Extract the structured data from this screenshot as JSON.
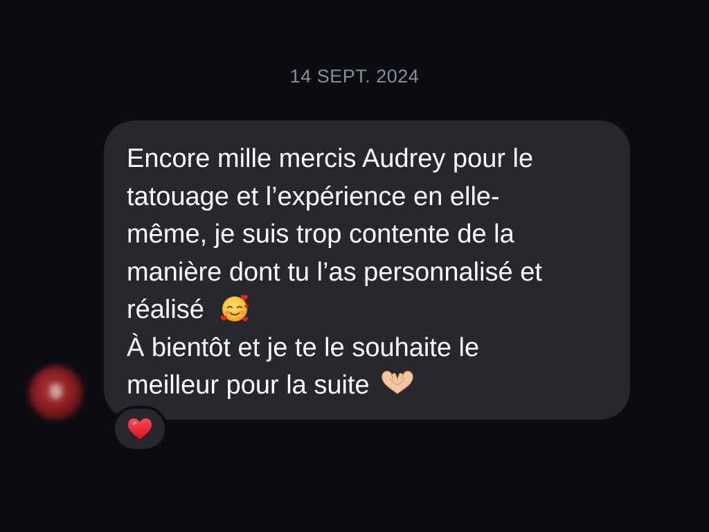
{
  "conversation": {
    "date_separator": "14 SEPT. 2024"
  },
  "message": {
    "lines": [
      "Encore mille mercis Audrey pour le",
      "tatouage et l’expérience en elle-",
      "même, je suis trop contente de la",
      "manière dont tu l’as personnalisé et",
      "réalisé",
      "À bientôt et je te le souhaite le",
      "meilleur pour la suite"
    ],
    "emojis": {
      "after_line_5": "smiling-face-with-hearts",
      "after_line_7": "heart-hands"
    },
    "bubble_color": "#26282e",
    "text_color": "#ffffff"
  },
  "reaction": {
    "icon": "red-heart-icon",
    "color": "#e8202c"
  },
  "sender": {
    "avatar": "blurred-avatar"
  },
  "theme": {
    "background": "#0b0d12",
    "date_color": "#8b8e96"
  }
}
